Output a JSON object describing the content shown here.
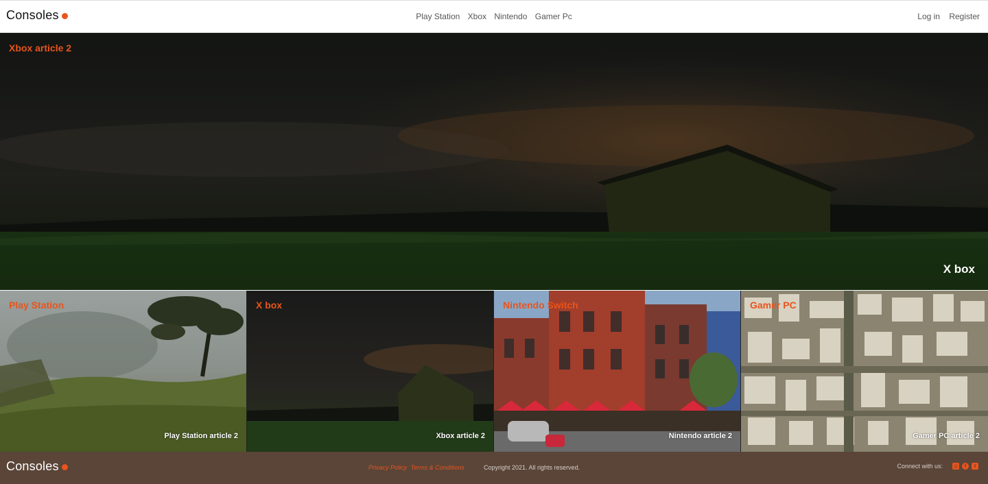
{
  "header": {
    "logo": "Consoles",
    "nav": [
      "Play Station",
      "Xbox",
      "Nintendo",
      "Gamer Pc"
    ],
    "auth": {
      "login": "Log in",
      "register": "Register"
    }
  },
  "hero": {
    "title": "Xbox article 2",
    "caption": "X box"
  },
  "cards": [
    {
      "title": "Play Station",
      "caption": "Play Station article 2"
    },
    {
      "title": "X box",
      "caption": "Xbox article 2"
    },
    {
      "title": "Nintendo Switch",
      "caption": "Nintendo article 2"
    },
    {
      "title": "Gamer PC",
      "caption": "Gamer PC article 2"
    }
  ],
  "footer": {
    "logo": "Consoles",
    "privacy": "Privacy Policy",
    "terms": "Terms & Conditions",
    "copyright": "Copyright 2021. All rights reserved.",
    "connect": "Connect with us:",
    "socials": [
      "instagram-icon",
      "facebook-icon",
      "twitter-icon"
    ]
  },
  "colors": {
    "accent": "#e8541c",
    "footer_bg": "#5a4538"
  }
}
